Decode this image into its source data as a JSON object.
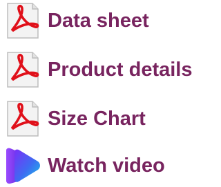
{
  "links": [
    {
      "label": "Data sheet",
      "icon": "pdf-file-icon"
    },
    {
      "label": "Product details",
      "icon": "pdf-file-icon"
    },
    {
      "label": "Size Chart",
      "icon": "pdf-file-icon"
    },
    {
      "label": "Watch video",
      "icon": "video-play-icon"
    }
  ],
  "colors": {
    "link_text": "#78245f",
    "pdf_red": "#e0101a",
    "video_purple": "#7b2ff7",
    "video_cyan": "#19c6e6"
  }
}
